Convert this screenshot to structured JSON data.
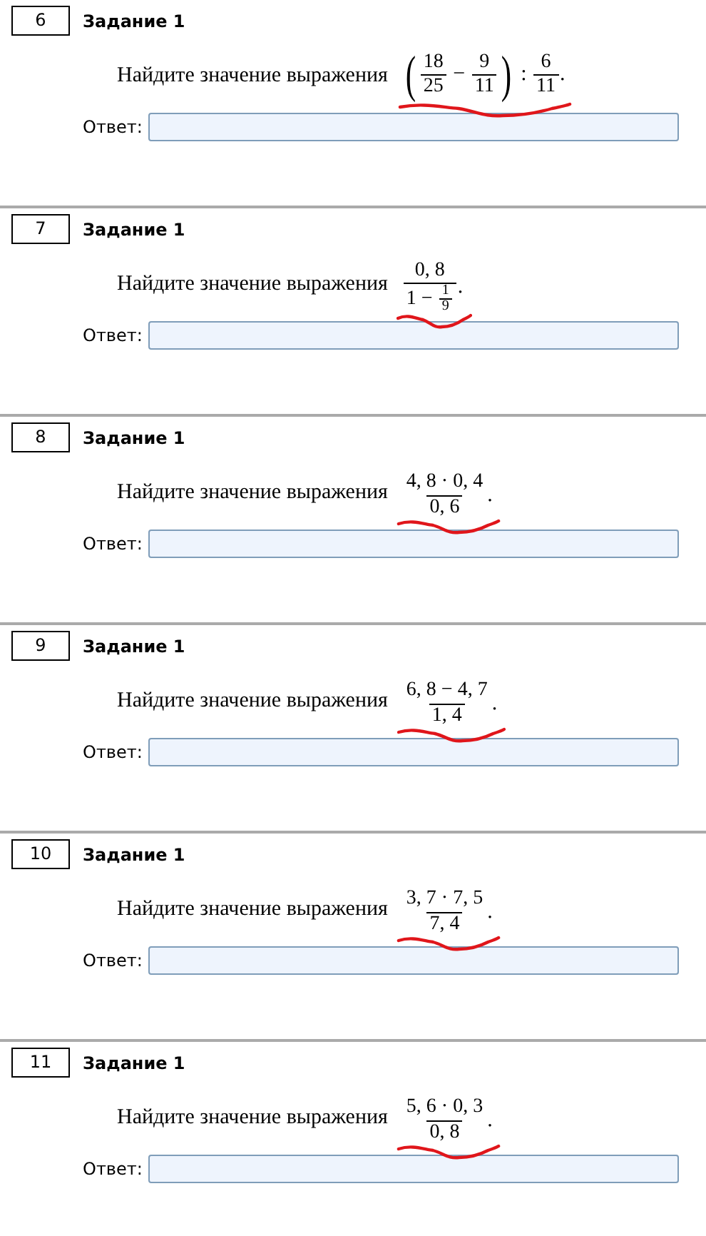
{
  "tasks": [
    {
      "number": "6",
      "title": "Задание 1",
      "prompt": "Найдите значение выражения",
      "underlined": true,
      "expression": [
        {
          "kind": "paren",
          "open": "(",
          "close": ")",
          "children": [
            {
              "kind": "frac",
              "num": [
                {
                  "kind": "text",
                  "text": "18"
                }
              ],
              "den": [
                {
                  "kind": "text",
                  "text": "25"
                }
              ]
            },
            {
              "kind": "text",
              "text": " − "
            },
            {
              "kind": "frac",
              "num": [
                {
                  "kind": "text",
                  "text": "9"
                }
              ],
              "den": [
                {
                  "kind": "text",
                  "text": "11"
                }
              ]
            }
          ]
        },
        {
          "kind": "text",
          "text": " : "
        },
        {
          "kind": "frac",
          "num": [
            {
              "kind": "text",
              "text": "6"
            }
          ],
          "den": [
            {
              "kind": "text",
              "text": "11"
            }
          ]
        },
        {
          "kind": "text",
          "text": "."
        }
      ],
      "answer_label": "Ответ:"
    },
    {
      "number": "7",
      "title": "Задание 1",
      "prompt": "Найдите значение выражения",
      "underlined": true,
      "expression": [
        {
          "kind": "frac",
          "num": [
            {
              "kind": "text",
              "text": "0, 8"
            }
          ],
          "den": [
            {
              "kind": "text",
              "text": "1 − "
            },
            {
              "kind": "smallfrac",
              "num": [
                {
                  "kind": "text",
                  "text": "1"
                }
              ],
              "den": [
                {
                  "kind": "text",
                  "text": "9"
                }
              ]
            }
          ]
        },
        {
          "kind": "text",
          "text": "."
        }
      ],
      "answer_label": "Ответ:"
    },
    {
      "number": "8",
      "title": "Задание 1",
      "prompt": "Найдите значение выражения",
      "underlined": true,
      "expression": [
        {
          "kind": "frac",
          "num": [
            {
              "kind": "text",
              "text": "4, 8 · 0, 4"
            }
          ],
          "den": [
            {
              "kind": "text",
              "text": "0, 6"
            }
          ]
        },
        {
          "kind": "text",
          "text": "."
        }
      ],
      "answer_label": "Ответ:"
    },
    {
      "number": "9",
      "title": "Задание 1",
      "prompt": "Найдите значение выражения",
      "underlined": true,
      "expression": [
        {
          "kind": "frac",
          "num": [
            {
              "kind": "text",
              "text": "6, 8 − 4, 7"
            }
          ],
          "den": [
            {
              "kind": "text",
              "text": "1, 4"
            }
          ]
        },
        {
          "kind": "text",
          "text": "."
        }
      ],
      "answer_label": "Ответ:"
    },
    {
      "number": "10",
      "title": "Задание 1",
      "prompt": "Найдите значение выражения",
      "underlined": true,
      "expression": [
        {
          "kind": "frac",
          "num": [
            {
              "kind": "text",
              "text": "3, 7 · 7, 5"
            }
          ],
          "den": [
            {
              "kind": "text",
              "text": "7, 4"
            }
          ]
        },
        {
          "kind": "text",
          "text": "."
        }
      ],
      "answer_label": "Ответ:"
    },
    {
      "number": "11",
      "title": "Задание 1",
      "prompt": "Найдите значение выражения",
      "underlined": true,
      "expression": [
        {
          "kind": "frac",
          "num": [
            {
              "kind": "text",
              "text": "5, 6 · 0, 3"
            }
          ],
          "den": [
            {
              "kind": "text",
              "text": "0, 8"
            }
          ]
        },
        {
          "kind": "text",
          "text": "."
        }
      ],
      "answer_label": "Ответ:"
    }
  ]
}
